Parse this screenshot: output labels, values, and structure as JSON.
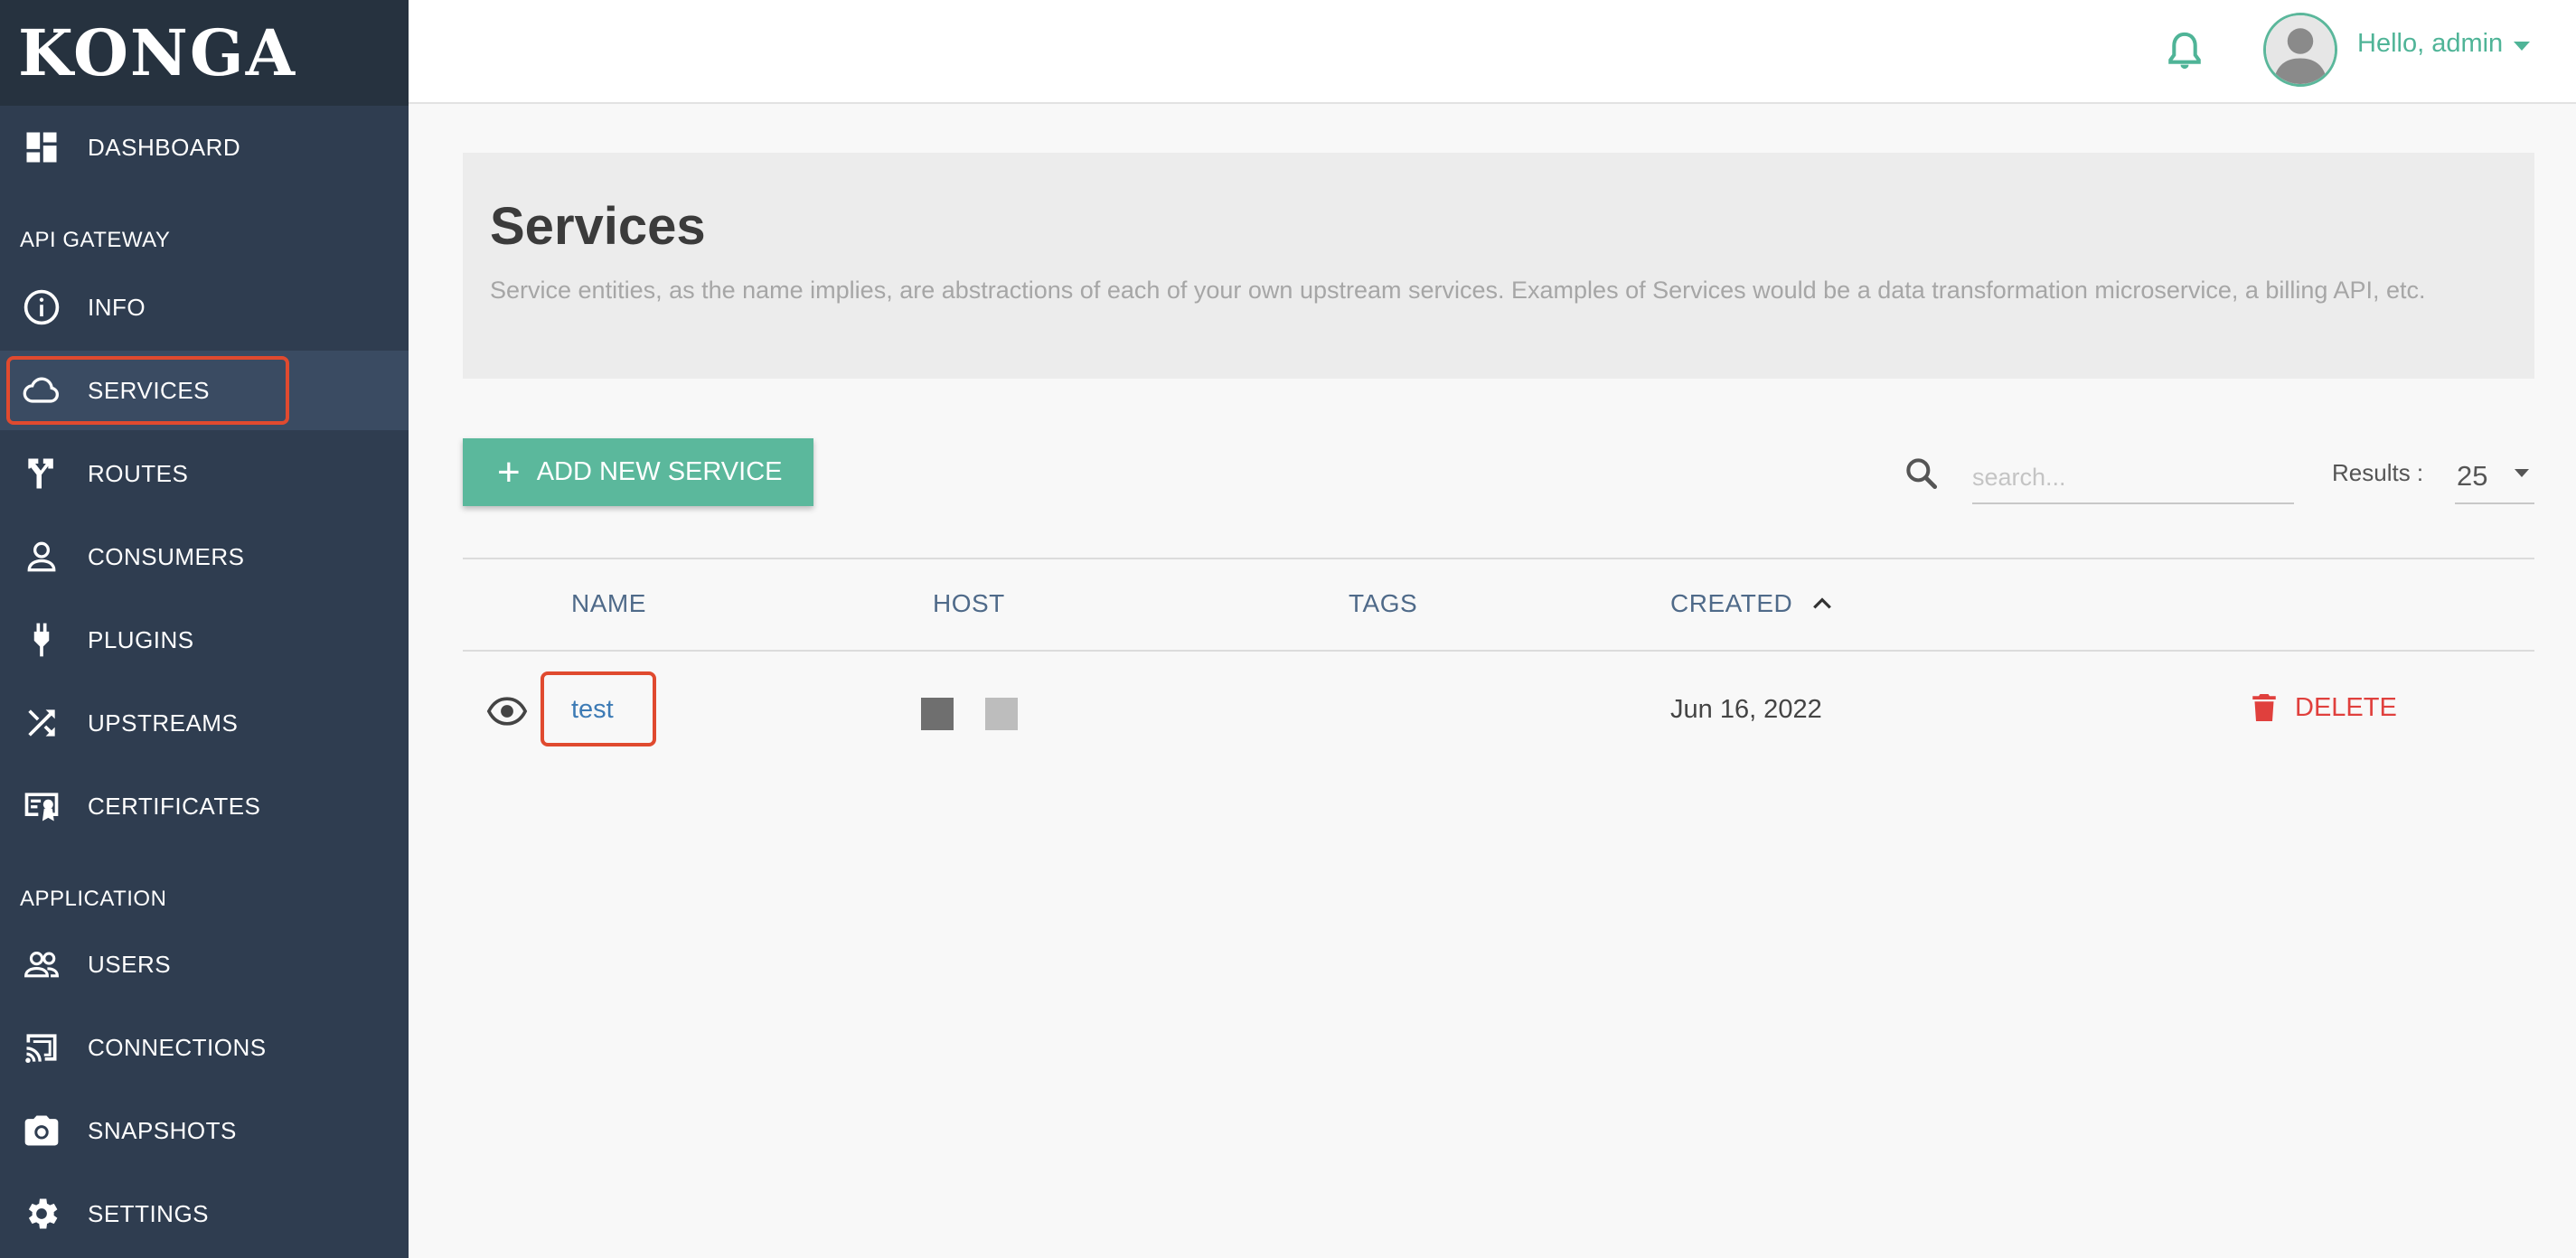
{
  "app": {
    "logo": "KONGA"
  },
  "sidebar": {
    "dashboard": "DASHBOARD",
    "sections": [
      {
        "title": "API GATEWAY"
      },
      {
        "title": "APPLICATION"
      }
    ],
    "items": [
      {
        "label": "INFO",
        "icon": "info-icon"
      },
      {
        "label": "SERVICES",
        "icon": "cloud-icon",
        "active": true
      },
      {
        "label": "ROUTES",
        "icon": "routes-icon"
      },
      {
        "label": "CONSUMERS",
        "icon": "person-icon"
      },
      {
        "label": "PLUGINS",
        "icon": "plug-icon"
      },
      {
        "label": "UPSTREAMS",
        "icon": "shuffle-icon"
      },
      {
        "label": "CERTIFICATES",
        "icon": "certificate-icon"
      },
      {
        "label": "USERS",
        "icon": "users-icon"
      },
      {
        "label": "CONNECTIONS",
        "icon": "cast-icon"
      },
      {
        "label": "SNAPSHOTS",
        "icon": "camera-icon"
      },
      {
        "label": "SETTINGS",
        "icon": "gear-icon"
      }
    ]
  },
  "topbar": {
    "greeting": "Hello, admin",
    "accent_color": "#4fb497"
  },
  "header": {
    "title": "Services",
    "description": "Service entities, as the name implies, are abstractions of each of your own upstream services. Examples of Services would be a data transformation microservice, a billing API, etc."
  },
  "toolbar": {
    "add_label": "ADD NEW SERVICE",
    "search_placeholder": "search...",
    "results_label": "Results :",
    "results_value": "25"
  },
  "table": {
    "columns": [
      "NAME",
      "HOST",
      "TAGS",
      "CREATED"
    ],
    "rows": [
      {
        "name": "test",
        "created": "Jun 16, 2022",
        "delete_label": "DELETE"
      }
    ]
  }
}
